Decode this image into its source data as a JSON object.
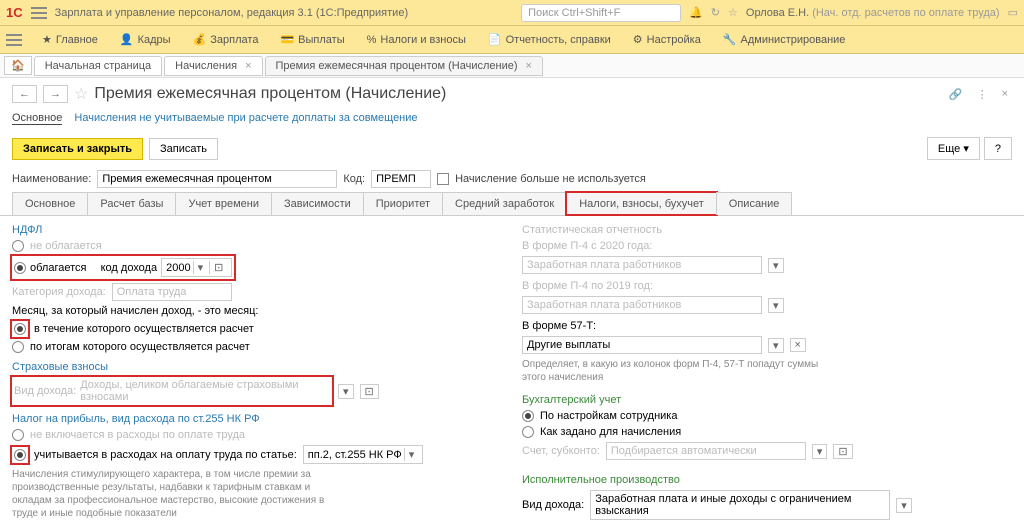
{
  "app": {
    "title": "Зарплата и управление персоналом, редакция 3.1  (1С:Предприятие)",
    "search_placeholder": "Поиск Ctrl+Shift+F",
    "user": "Орлова Е.Н.",
    "user_role": "(Нач. отд. расчетов по оплате труда)"
  },
  "menu": {
    "main": "Главное",
    "kadry": "Кадры",
    "zarplata": "Зарплата",
    "vyplaty": "Выплаты",
    "nalogi": "Налоги и взносы",
    "otchet": "Отчетность, справки",
    "nastroika": "Настройка",
    "admin": "Администрирование"
  },
  "breadcrumb": {
    "home": "Начальная страница",
    "tab1": "Начисления",
    "tab2": "Премия ежемесячная процентом (Начисление)"
  },
  "page": {
    "title": "Премия ежемесячная процентом (Начисление)",
    "link_main": "Основное",
    "link_secondary": "Начисления не учитываемые при расчете доплаты за совмещение",
    "btn_save_close": "Записать и закрыть",
    "btn_save": "Записать",
    "btn_more": "Еще",
    "name_label": "Наименование:",
    "name_value": "Премия ежемесячная процентом",
    "code_label": "Код:",
    "code_value": "ПРЕМП",
    "not_used_label": "Начисление больше не используется"
  },
  "tabs": {
    "t1": "Основное",
    "t2": "Расчет базы",
    "t3": "Учет времени",
    "t4": "Зависимости",
    "t5": "Приоритет",
    "t6": "Средний заработок",
    "t7": "Налоги, взносы, бухучет",
    "t8": "Описание"
  },
  "ndfl": {
    "title": "НДФЛ",
    "not_taxed": "не облагается",
    "taxed": "облагается",
    "code_label": "код дохода",
    "code_value": "2000",
    "category_label": "Категория дохода:",
    "category_value": "Оплата труда",
    "month_label": "Месяц, за который начислен доход, - это месяц:",
    "opt1": "в течение которого осуществляется расчет",
    "opt2": "по итогам которого осуществляется расчет"
  },
  "insurance": {
    "title": "Страховые взносы",
    "type_label": "Вид дохода:",
    "type_value": "Доходы, целиком облагаемые страховыми взносами"
  },
  "profit": {
    "title": "Налог на прибыль, вид расхода по ст.255 НК РФ",
    "opt1": "не включается в расходы по оплате труда",
    "opt2": "учитывается в расходах на оплату труда по статье:",
    "article_value": "пп.2, ст.255 НК РФ",
    "note": "Начисления стимулирующего характера, в том числе премии за производственные результаты, надбавки к тарифным ставкам и окладам за профессиональное мастерство, высокие достижения в труде и иные подобные показатели"
  },
  "stat": {
    "title": "Статистическая отчетность",
    "p4_2020": "В форме П-4 с 2020 года:",
    "p4_2020_val": "Заработная плата работников",
    "p4_2019": "В форме П-4 по 2019 год:",
    "p4_2019_val": "Заработная плата работников",
    "f57": "В форме 57-Т:",
    "f57_val": "Другие выплаты",
    "note": "Определяет, в какую из колонок форм П-4, 57-Т попадут суммы этого начисления"
  },
  "accounting": {
    "title": "Бухгалтерский учет",
    "opt1": "По настройкам сотрудника",
    "opt2": "Как задано для начисления",
    "account_label": "Счет, субконто:",
    "account_value": "Подбирается автоматически"
  },
  "execution": {
    "title": "Исполнительное производство",
    "type_label": "Вид дохода:",
    "type_value": "Заработная плата и иные доходы с ограничением взыскания"
  }
}
